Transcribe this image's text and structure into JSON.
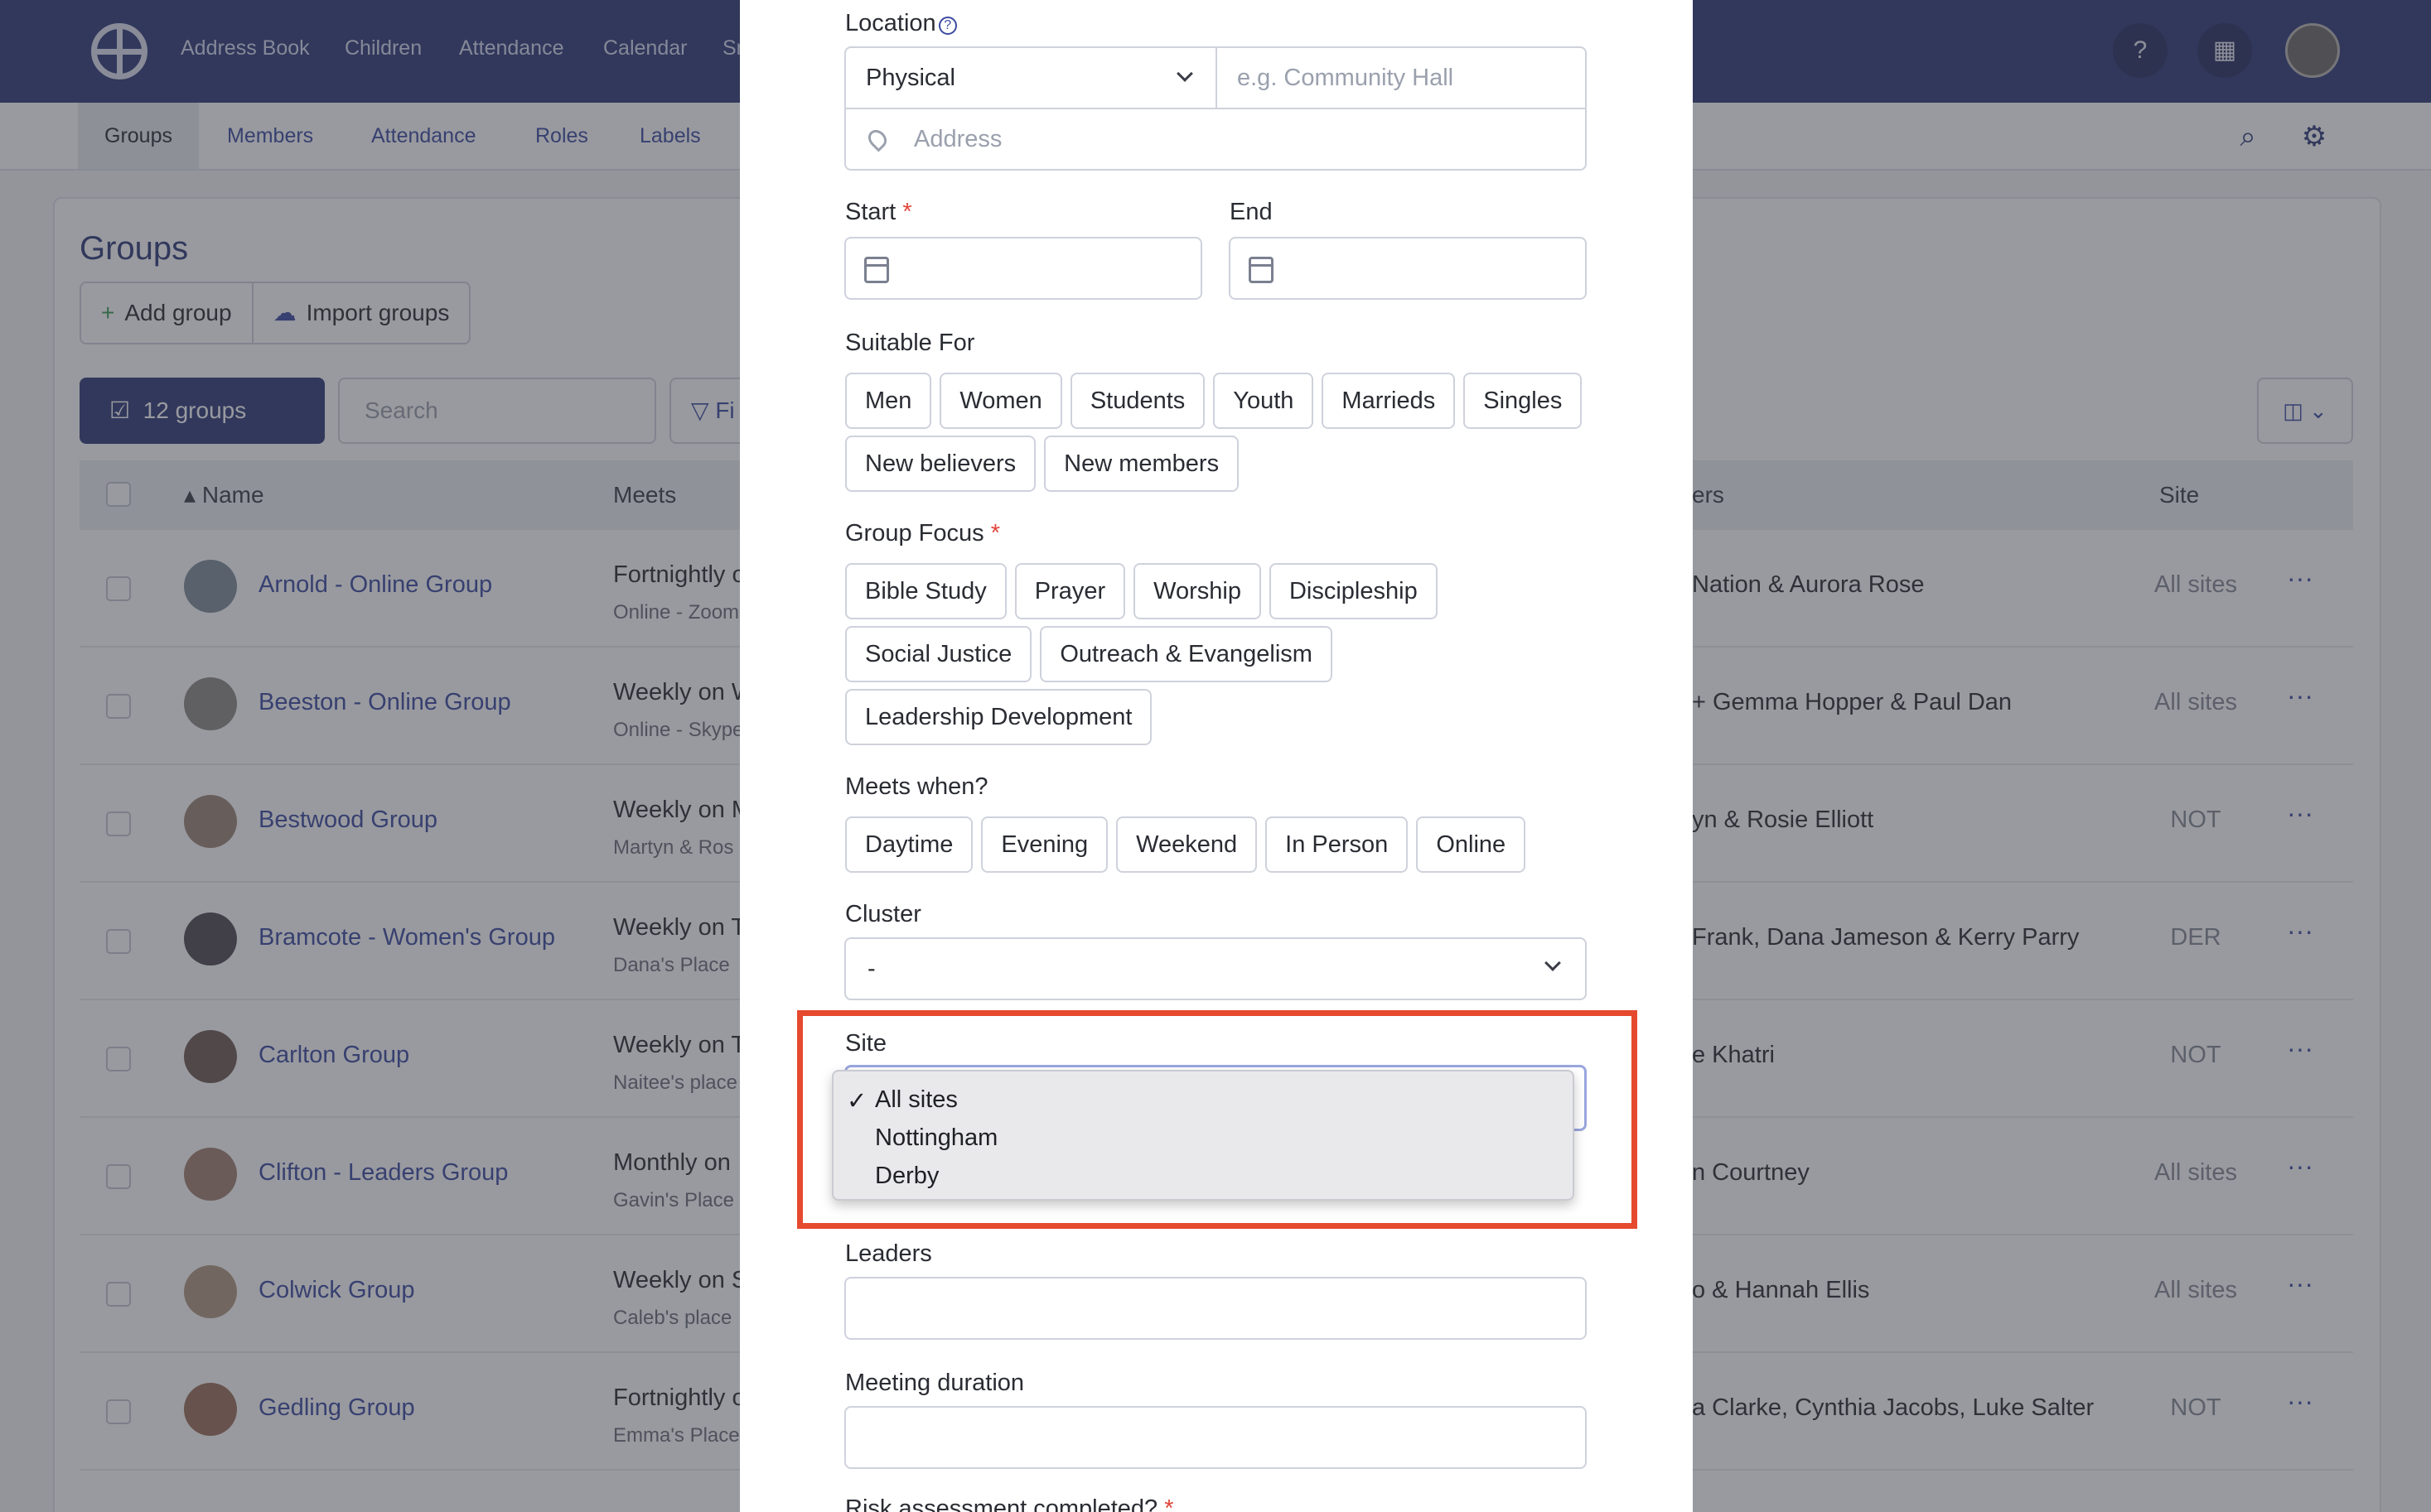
{
  "app": {
    "nav": [
      "Address Book",
      "Children",
      "Attendance",
      "Calendar",
      "Sm"
    ],
    "subnav": [
      "Groups",
      "Members",
      "Attendance",
      "Roles",
      "Labels"
    ],
    "help_glyph": "?",
    "building_glyph": "▦",
    "search_glyph": "⌕",
    "settings_glyph": "⚙",
    "icons": [
      "logo-icon",
      "help-icon",
      "building-icon",
      "avatar",
      "search-icon",
      "settings-icon"
    ]
  },
  "groups_page": {
    "title": "Groups",
    "add_group": "Add group",
    "import_groups": "Import groups",
    "plus_glyph": "+",
    "cloud_glyph": "☁",
    "selection_label": "12 groups",
    "selection_glyph": "☑",
    "search_placeholder": "Search",
    "filter_label": "▽ Fi",
    "columns_glyph": "◫ ⌄",
    "headers": {
      "name": "Name",
      "meets": "Meets",
      "leaders": "ers",
      "site": "Site",
      "sort_glyph": "▴"
    },
    "more_glyph": "···",
    "rows": [
      {
        "name": "Arnold - Online Group",
        "meets": "Fortnightly o",
        "location": "Online - Zoom",
        "leaders": "Nation & Aurora Rose",
        "site": "All sites"
      },
      {
        "name": "Beeston - Online Group",
        "meets": "Weekly on W",
        "location": "Online - Skype",
        "leaders": "+ Gemma Hopper & Paul Dan",
        "site": "All sites"
      },
      {
        "name": "Bestwood Group",
        "meets": "Weekly on M",
        "location": "Martyn & Ros",
        "leaders": "yn & Rosie Elliott",
        "site": "NOT"
      },
      {
        "name": "Bramcote - Women's Group",
        "meets": "Weekly on T",
        "location": "Dana's Place",
        "leaders": "Frank, Dana Jameson & Kerry Parry",
        "site": "DER"
      },
      {
        "name": "Carlton Group",
        "meets": "Weekly on T",
        "location": "Naitee's place",
        "leaders": "e Khatri",
        "site": "NOT"
      },
      {
        "name": "Clifton - Leaders Group",
        "meets": "Monthly on",
        "location": "Gavin's Place",
        "leaders": "n Courtney",
        "site": "All sites"
      },
      {
        "name": "Colwick Group",
        "meets": "Weekly on S",
        "location": "Caleb's place",
        "leaders": "o & Hannah Ellis",
        "site": "All sites"
      },
      {
        "name": "Gedling Group",
        "meets": "Fortnightly o",
        "location": "Emma's Place",
        "leaders": "a Clarke, Cynthia Jacobs, Luke Salter",
        "site": "NOT"
      }
    ]
  },
  "form": {
    "location_label": "Location",
    "info_glyph": "?",
    "location_type": "Physical",
    "location_name_placeholder": "e.g. Community Hall",
    "address_placeholder": "Address",
    "address_icon": "map-pin-icon",
    "start_label": "Start",
    "end_label": "End",
    "required_mark": "*",
    "suitable_for_label": "Suitable For",
    "suitable_for": [
      "Men",
      "Women",
      "Students",
      "Youth",
      "Marrieds",
      "Singles",
      "New believers",
      "New members"
    ],
    "group_focus_label": "Group Focus",
    "group_focus": [
      "Bible Study",
      "Prayer",
      "Worship",
      "Discipleship",
      "Social Justice",
      "Outreach & Evangelism",
      "Leadership Development"
    ],
    "meets_when_label": "Meets when?",
    "meets_when": [
      "Daytime",
      "Evening",
      "Weekend",
      "In Person",
      "Online"
    ],
    "cluster_label": "Cluster",
    "cluster_value": "-",
    "site_label": "Site",
    "site_options": [
      "All sites",
      "Nottingham",
      "Derby"
    ],
    "site_selected": "All sites",
    "check_glyph": "✓",
    "leaders_label": "Leaders",
    "meeting_duration_label": "Meeting duration",
    "risk_label": "Risk assessment completed?"
  },
  "colors": {
    "topbar": "#2e3a78",
    "accent": "#3b4aa0",
    "highlight": "#e54a2f",
    "required": "#e1463a"
  }
}
